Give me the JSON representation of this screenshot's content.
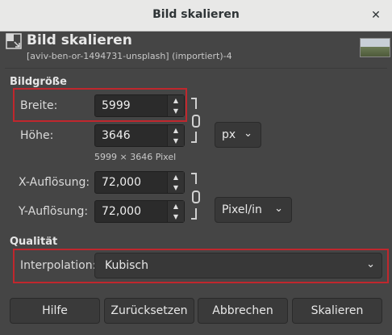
{
  "window": {
    "title": "Bild skalieren",
    "close_label": "✕"
  },
  "header": {
    "title": "Bild skalieren",
    "subtitle": "[aviv-ben-or-1494731-unsplash] (importiert)-4"
  },
  "size": {
    "section": "Bildgröße",
    "width_label": "Breite:",
    "width_value": "5999",
    "height_label": "Höhe:",
    "height_value": "3646",
    "unit": "px",
    "pixel_info": "5999 × 3646 Pixel"
  },
  "resolution": {
    "x_label": "X-Auflösung:",
    "x_value": "72,000",
    "y_label": "Y-Auflösung:",
    "y_value": "72,000",
    "unit": "Pixel/in"
  },
  "quality": {
    "section": "Qualität",
    "interpolation_label": "Interpolation:",
    "interpolation_value": "Kubisch"
  },
  "buttons": {
    "help": "Hilfe",
    "reset": "Zurücksetzen",
    "cancel": "Abbrechen",
    "scale": "Skalieren"
  },
  "colors": {
    "background": "#454545",
    "highlight": "#c0272d",
    "titlebar": "#e8e8e7"
  },
  "icons": {
    "header": "scale-image-icon",
    "close": "close-icon",
    "chain": "chain-link-icon",
    "dropdown": "chevron-down-icon"
  }
}
